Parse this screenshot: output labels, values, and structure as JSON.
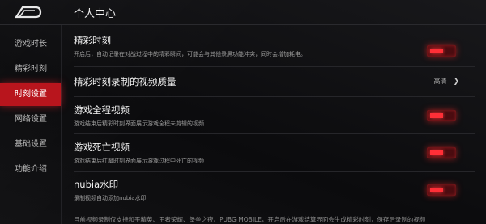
{
  "header": {
    "title": "个人中心",
    "logo": "nubia-red-logo"
  },
  "sidebar": {
    "items": [
      {
        "label": "游戏时长",
        "active": false
      },
      {
        "label": "精彩时刻",
        "active": false
      },
      {
        "label": "时刻设置",
        "active": true
      },
      {
        "label": "网络设置",
        "active": false
      },
      {
        "label": "基础设置",
        "active": false
      },
      {
        "label": "功能介绍",
        "active": false
      }
    ]
  },
  "settings": [
    {
      "title": "精彩时刻",
      "desc": "开启后，自动记录在对战过程中的精彩瞬间，可能会与其他录屏功能冲突，同时会增加耗电。",
      "control": "toggle",
      "on": true
    },
    {
      "title": "精彩时刻录制的视频质量",
      "desc": "",
      "control": "select",
      "value": "高清",
      "icon": "chevron-right-icon"
    },
    {
      "title": "游戏全程视频",
      "desc": "游戏结束后精彩时刻界面展示游戏全程未剪辑的视频",
      "control": "toggle",
      "on": true
    },
    {
      "title": "游戏死亡视频",
      "desc": "游戏结束后红魔时刻界面展示游戏过程中死亡的视频",
      "control": "toggle",
      "on": true
    },
    {
      "title": "nubia水印",
      "desc": "录制视频自动添加nubia水印",
      "control": "toggle",
      "on": true
    }
  ],
  "footer": {
    "note": "目前视频录制仅支持和平精英、王者荣耀、堡垒之夜、PUBG MOBILE，开启后在游戏结算界面会生成精彩时刻，保存后录制的视频"
  },
  "colors": {
    "accent": "#b8151d",
    "toggle_on": "#ff2f37",
    "background": "#0e0e10"
  }
}
